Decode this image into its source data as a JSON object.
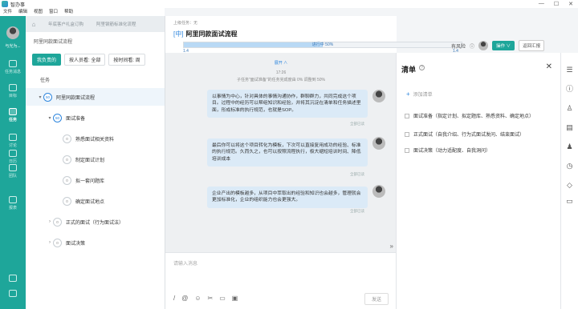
{
  "titlebar": {
    "app_name": "智办事",
    "min": "—",
    "max": "☐",
    "close": "✕"
  },
  "menubar": [
    "文件",
    "编辑",
    "视图",
    "窗口",
    "帮助"
  ],
  "sidebar": {
    "username": "与光为...",
    "items": [
      {
        "label": "任务消息",
        "active": false
      },
      {
        "label": "目标",
        "active": false
      },
      {
        "label": "任务",
        "active": true
      },
      {
        "label": "讨论",
        "active": false
      },
      {
        "label": "日历",
        "active": false
      },
      {
        "label": "团队",
        "active": false
      },
      {
        "label": "报表",
        "active": false
      }
    ]
  },
  "tabs": [
    "年底客户礼盒订购",
    "阿里钢筋标准化流程"
  ],
  "list": {
    "project_title": "阿里同款面试流程",
    "responsible_btn": "我负责的",
    "filter_member": "按人员看: 全部",
    "filter_time": "按时间看: 周",
    "column_header": "任务",
    "rows": [
      {
        "indent": 0,
        "arrow": "▾",
        "badge": "50",
        "label": "阿里同款面试流程",
        "selected": true,
        "blue": true
      },
      {
        "indent": 1,
        "arrow": "▾",
        "badge": "50",
        "label": "面试准备",
        "selected": false,
        "blue": true
      },
      {
        "indent": 2,
        "arrow": "",
        "badge": "0",
        "label": "熟悉面试相关资料",
        "selected": false,
        "blue": false
      },
      {
        "indent": 2,
        "arrow": "",
        "badge": "0",
        "label": "制定面试计划",
        "selected": false,
        "blue": false
      },
      {
        "indent": 2,
        "arrow": "",
        "badge": "0",
        "label": "拟一套问题库",
        "selected": false,
        "blue": false
      },
      {
        "indent": 2,
        "arrow": "",
        "badge": "0",
        "label": "确定面试地点",
        "selected": false,
        "blue": false
      },
      {
        "indent": 1,
        "arrow": "›",
        "badge": "0",
        "label": "正式的面试（行为面试法）",
        "selected": false,
        "blue": false
      },
      {
        "indent": 1,
        "arrow": "›",
        "badge": "0",
        "label": "面试决策",
        "selected": false,
        "blue": false
      }
    ]
  },
  "chat": {
    "parent_task": "上级任务：无",
    "title_tag": "[中]",
    "title": "阿里同款面试流程",
    "progress_text": "进行中 50%",
    "progress_value": 0.5,
    "progress_start": "1.4",
    "progress_end": "1.4",
    "expand": "展开 ∧",
    "time": "17:26",
    "system_msg": "子任务\"面试准备\"的任务完成度由 0% 调整到 50%",
    "messages": [
      {
        "text": "以事情为中心，针对具体的事情沟通协作，群聊群力，共同完成这个项目。过程中的经历可以帮组知识和经验，并将其沉淀在清单和任务描述里面，形成标准的执行规范，也就是SOP。",
        "meta": "全部已读"
      },
      {
        "text": "最后你可以将这个项目转化为模板，下次可以直接复用成功的经验、标准的执行规范。久而久之，也可以按照流程执行，极大缩短培训时间、降低培训成本",
        "meta": "全部已读"
      },
      {
        "text": "企业产出的模板越多，从项目中萃取出的经验和知识也会越多，管理就会更加标准化，企业的组织能力也会更强大。",
        "meta": "全部已读"
      }
    ],
    "composer_placeholder": "请输入消息",
    "send": "发送",
    "collapse_glyph": "»"
  },
  "header_right": {
    "risk": "有风险",
    "operate": "操作 ∨",
    "back": "返回汇报"
  },
  "checklist": {
    "title": "清单",
    "help": "?",
    "close": "✕",
    "add_label": "添加清单",
    "items": [
      "面试准备（指定计划、拟定题库、熟悉资料、确定地点）",
      "正式面试（自我介绍、行为式面试发问、结束面试）",
      "面试决策（动力适配度、自我洞问）"
    ]
  },
  "colors": {
    "accent": "#1ea69a",
    "blue": "#2e86de",
    "bubble": "#dbeaf7"
  },
  "rail_icons": [
    "list-icon",
    "info-icon",
    "user-share-icon",
    "document-check-icon",
    "person-icon",
    "clock-icon",
    "tag-icon",
    "folder-icon"
  ]
}
